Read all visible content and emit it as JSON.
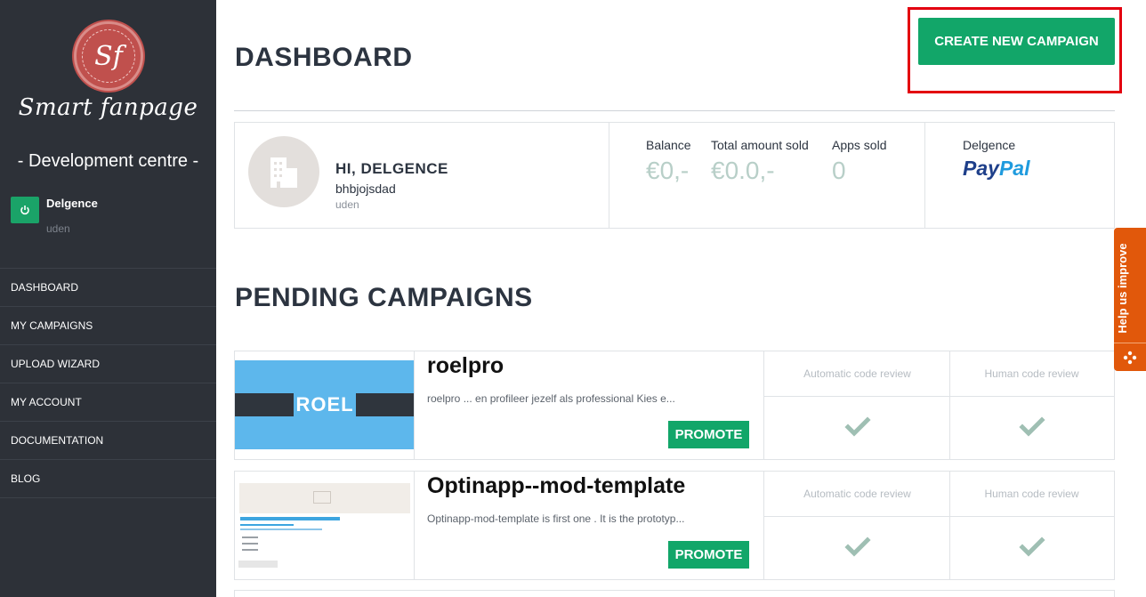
{
  "sidebar": {
    "logo_monogram": "Sf",
    "logo_text": "Smart fanpage",
    "subtitle": "- Development centre -",
    "user": {
      "power_icon": "power-icon",
      "name": "Delgence",
      "location": "uden"
    },
    "nav": [
      {
        "label": "DASHBOARD"
      },
      {
        "label": "MY CAMPAIGNS"
      },
      {
        "label": "UPLOAD WIZARD"
      },
      {
        "label": "MY ACCOUNT"
      },
      {
        "label": "DOCUMENTATION"
      },
      {
        "label": "BLOG"
      }
    ]
  },
  "header": {
    "title": "DASHBOARD",
    "create_button": "CREATE NEW CAMPAIGN"
  },
  "profile": {
    "avatar_icon": "building-icon",
    "greeting": "HI, DELGENCE",
    "company": "bhbjojsdad",
    "city": "uden",
    "stats": [
      {
        "label": "Balance",
        "value": "€0,-"
      },
      {
        "label": "Total amount sold",
        "value": "€0.0,-"
      },
      {
        "label": "Apps sold",
        "value": "0"
      }
    ],
    "payout": {
      "name": "Delgence",
      "logo_part1": "Pay",
      "logo_part2": "Pal"
    }
  },
  "pending": {
    "title": "PENDING CAMPAIGNS",
    "campaigns": [
      {
        "title": "roelpro",
        "description": "roelpro ... en profileer jezelf als professional Kies e...",
        "thumb_label": "ROEL",
        "promote": "PROMOTE",
        "auto_review": "Automatic code review",
        "human_review": "Human code review"
      },
      {
        "title": "Optinapp--mod-template",
        "description": "Optinapp-mod-template is first one . It is the prototyp...",
        "promote": "PROMOTE",
        "auto_review": "Automatic code review",
        "human_review": "Human code review"
      }
    ]
  },
  "help_tab": {
    "label": "Help us improve",
    "icon": "feedback-dots-icon"
  },
  "colors": {
    "sidebar": "#2d3138",
    "accent_green": "#12a669",
    "highlight_red": "#e3000f",
    "help_orange": "#e1580b",
    "stat_value": "#b8cfc8"
  }
}
